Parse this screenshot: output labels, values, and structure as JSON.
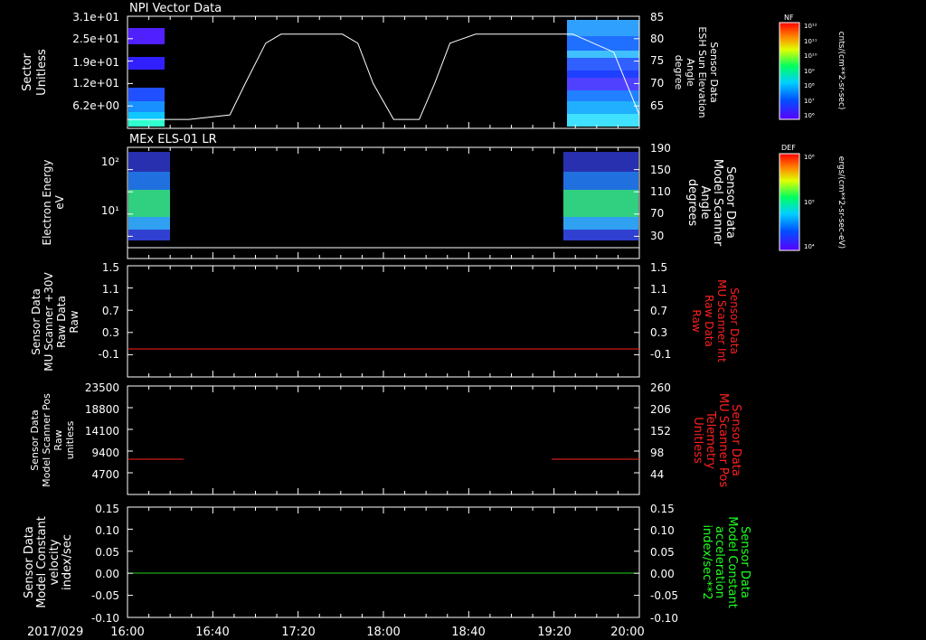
{
  "chart_data": {
    "type": "line",
    "date": "2017/029",
    "x_ticks": [
      "16:00",
      "16:40",
      "17:20",
      "18:00",
      "18:40",
      "19:20",
      "20:00"
    ],
    "panels": [
      {
        "id": "p1",
        "title": "NPI Vector Data",
        "type": "heatmap",
        "left_label": [
          "Sector",
          "Unitless"
        ],
        "left_ticks": [
          "3.1e+01",
          "2.5e+01",
          "1.9e+01",
          "1.2e+01",
          "6.2e+00"
        ],
        "right_label": [
          "Sensor Data",
          "ESH Sun Elevation",
          "Angle",
          "degree"
        ],
        "right_ticks": [
          "85",
          "80",
          "75",
          "70",
          "65"
        ],
        "colorbar": {
          "title": "NF",
          "unit_label": "cnts/(cm**2-sr-sec)",
          "ticks": [
            "10¹²",
            "10¹¹",
            "10¹⁰",
            "10⁹",
            "10⁸",
            "10⁷",
            "10⁶"
          ]
        },
        "sun_elevation": {
          "x_frac": [
            0,
            0.12,
            0.2,
            0.23,
            0.27,
            0.3,
            0.42,
            0.45,
            0.48,
            0.52,
            0.57,
            0.6,
            0.63,
            0.68,
            0.87,
            0.95,
            1.0
          ],
          "y_deg": [
            62,
            62,
            63,
            70,
            79,
            81,
            81,
            79,
            70,
            62,
            62,
            70,
            79,
            81,
            81,
            77,
            63
          ]
        }
      },
      {
        "id": "p2",
        "title": "MEx ELS-01 LR",
        "type": "heatmap",
        "left_label": [
          "Electron Energy",
          "eV"
        ],
        "left_ticks": [
          "10²",
          "10¹"
        ],
        "right_label": [
          "Sensor Data",
          "Model Scanner",
          "Angle",
          "degrees"
        ],
        "right_ticks": [
          "190",
          "150",
          "110",
          "70",
          "30"
        ],
        "colorbar": {
          "title": "DEF",
          "unit_label": "ergs/(cm**2-sr-sec-eV)",
          "ticks": [
            "10⁶",
            "10⁵",
            "10⁴"
          ]
        }
      },
      {
        "id": "p3",
        "type": "line",
        "left_label": [
          "Sensor Data",
          "MU Scanner +30V",
          "Raw Data",
          "Raw"
        ],
        "left_ticks": [
          "1.5",
          "1.1",
          "0.7",
          "0.3",
          "-0.1"
        ],
        "right_label": [
          "Sensor Data",
          "MU Scanner Int",
          "Raw Data",
          "Raw"
        ],
        "right_color": "#ff2020",
        "right_ticks": [
          "1.5",
          "1.1",
          "0.7",
          "0.3",
          "-0.1"
        ],
        "series": [
          {
            "x_range": [
              0,
              1
            ],
            "y": 0,
            "color": "#ff2020"
          }
        ],
        "ylim": [
          -0.3,
          1.5
        ]
      },
      {
        "id": "p4",
        "type": "line",
        "left_label": [
          "Sensor Data",
          "Model Scanner Pos",
          "Raw",
          "unitless"
        ],
        "left_ticks": [
          "23500",
          "18800",
          "14100",
          "9400",
          "4700"
        ],
        "right_label": [
          "Sensor Data",
          "MU Scanner Pos",
          "Telemetry",
          "Unitless"
        ],
        "right_color": "#ff2020",
        "right_ticks": [
          "260",
          "206",
          "152",
          "98",
          "44"
        ],
        "series": [
          {
            "x_range": [
              0,
              0.11
            ],
            "y": 86,
            "color": "#ff2020"
          },
          {
            "x_range": [
              0.82,
              1
            ],
            "y": 86,
            "color": "#ff2020"
          }
        ],
        "ylim": [
          0,
          260
        ]
      },
      {
        "id": "p5",
        "type": "line",
        "left_label": [
          "Sensor Data",
          "Model Constant",
          "velocity",
          "index/sec"
        ],
        "left_ticks": [
          "0.15",
          "0.10",
          "0.05",
          "0.00",
          "-0.05",
          "-0.10"
        ],
        "right_label": [
          "Sensor Data",
          "Model Constant",
          "acceleration",
          "index/sec**2"
        ],
        "right_color": "#20ff20",
        "right_ticks": [
          "0.15",
          "0.10",
          "0.05",
          "0.00",
          "-0.05",
          "-0.10"
        ],
        "series": [
          {
            "x_range": [
              0,
              1
            ],
            "y": 0,
            "color": "#20d020"
          }
        ],
        "ylim": [
          -0.1,
          0.15
        ]
      }
    ]
  }
}
